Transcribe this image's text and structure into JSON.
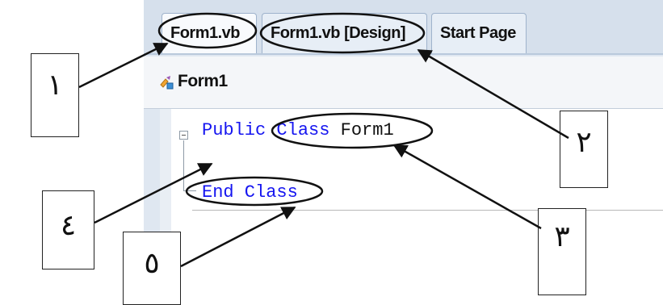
{
  "tabs": [
    {
      "label": "Form1.vb",
      "active": true
    },
    {
      "label": "Form1.vb [Design]",
      "active": false
    },
    {
      "label": "Start Page",
      "active": false
    }
  ],
  "navbar": {
    "label": "Form1",
    "icon": "class-icon"
  },
  "code": {
    "line1": {
      "keyword1": "Public",
      "keyword2": "Class",
      "name": "Form1"
    },
    "line2": {
      "keyword": "End Class"
    }
  },
  "callouts": [
    {
      "id": "1",
      "label": "١"
    },
    {
      "id": "2",
      "label": "٢"
    },
    {
      "id": "3",
      "label": "٣"
    },
    {
      "id": "4",
      "label": "٤"
    },
    {
      "id": "5",
      "label": "٥"
    }
  ],
  "colors": {
    "keyword": "#1515f0",
    "tab_strip": "#d6e0ec"
  }
}
